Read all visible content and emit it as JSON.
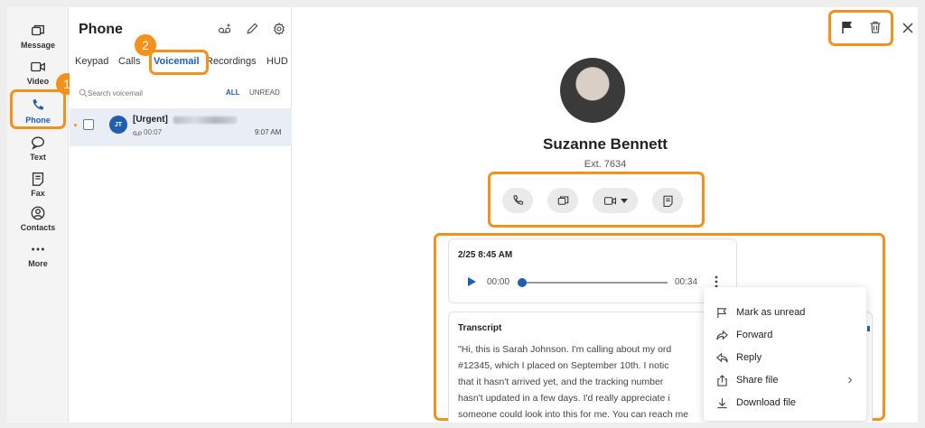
{
  "rail": {
    "items": [
      {
        "label": "Message",
        "icon": "message-icon"
      },
      {
        "label": "Video",
        "icon": "video-icon"
      },
      {
        "label": "Phone",
        "icon": "phone-icon"
      },
      {
        "label": "Text",
        "icon": "text-icon"
      },
      {
        "label": "Fax",
        "icon": "fax-icon"
      },
      {
        "label": "Contacts",
        "icon": "contacts-icon"
      },
      {
        "label": "More",
        "icon": "more-icon"
      }
    ]
  },
  "annotations": {
    "one": "1",
    "two": "2"
  },
  "panel": {
    "title": "Phone",
    "tabs": [
      "Keypad",
      "Calls",
      "Voicemail",
      "Recordings",
      "HUD"
    ],
    "search_placeholder": "Search voicemail",
    "filters": {
      "all": "ALL",
      "unread": "UNREAD"
    },
    "voicemail": {
      "initials": "JT",
      "title": "[Urgent]",
      "duration": "00:07",
      "time": "9:07 AM"
    }
  },
  "contact": {
    "name": "Suzanne Bennett",
    "ext": "Ext. 7634"
  },
  "player": {
    "date": "2/25 8:45 AM",
    "current": "00:00",
    "total": "00:34",
    "progress": 0
  },
  "transcript": {
    "heading": "Transcript",
    "lines": [
      "\"Hi, this is Sarah Johnson. I'm calling about my ord",
      "#12345, which I placed on September 10th. I notic",
      "that it hasn't arrived yet, and the tracking number",
      "hasn't updated in a few days. I'd really appreciate i",
      "someone could look into this for me. You can reach me"
    ]
  },
  "menu": {
    "items": [
      "Mark as unread",
      "Forward",
      "Reply",
      "Share file",
      "Download file"
    ]
  },
  "colors": {
    "accent": "#1f5fae",
    "highlight": "#f2911b"
  }
}
